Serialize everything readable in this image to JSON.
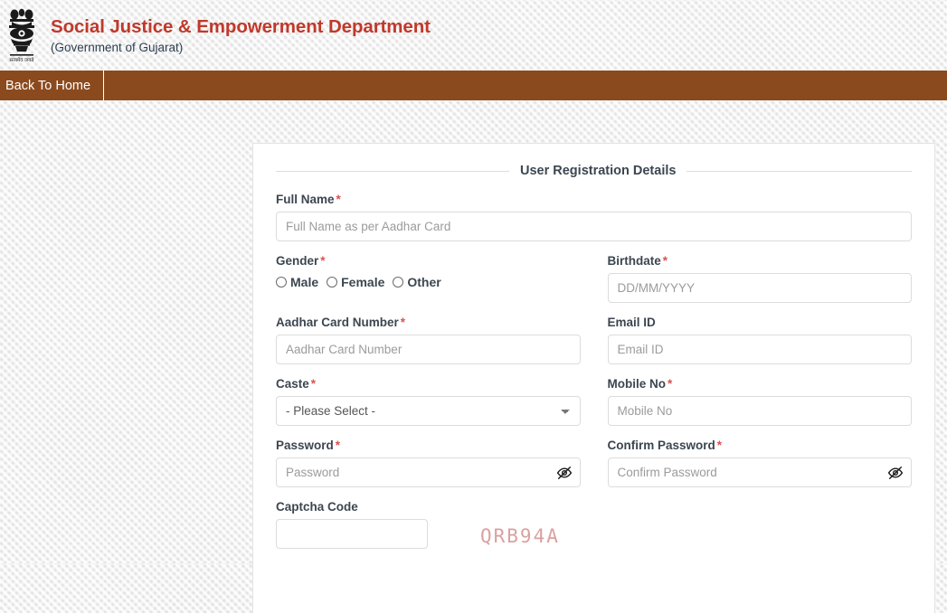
{
  "header": {
    "emblem_icon": "india-national-emblem",
    "title": "Social Justice & Empowerment Department",
    "subtitle": "(Government of Gujarat)",
    "title_color": "#c0392b"
  },
  "navbar": {
    "background_color": "#8b4a1e",
    "items": [
      {
        "label": "Back To Home"
      }
    ]
  },
  "form": {
    "legend": "User Registration Details",
    "required_marker": "*",
    "fields": {
      "full_name": {
        "label": "Full Name",
        "required_marker": "*",
        "placeholder": "Full Name as per Aadhar Card",
        "value": ""
      },
      "gender": {
        "label": "Gender",
        "required_marker": "*",
        "options": [
          "Male",
          "Female",
          "Other"
        ],
        "selected": ""
      },
      "birthdate": {
        "label": "Birthdate",
        "required_marker": "*",
        "placeholder": "DD/MM/YYYY",
        "value": ""
      },
      "aadhar": {
        "label": "Aadhar Card Number",
        "required_marker": "*",
        "placeholder": "Aadhar Card Number",
        "value": ""
      },
      "email": {
        "label": "Email ID",
        "required_marker": "",
        "placeholder": "Email ID",
        "value": ""
      },
      "caste": {
        "label": "Caste",
        "required_marker": "*",
        "selected": "- Please Select -",
        "options": [
          "- Please Select -"
        ]
      },
      "mobile": {
        "label": "Mobile No",
        "required_marker": "*",
        "placeholder": "Mobile No",
        "value": ""
      },
      "password": {
        "label": "Password",
        "required_marker": "*",
        "placeholder": "Password",
        "value": "",
        "toggle_icon": "eye-slash-icon"
      },
      "confirm_password": {
        "label": "Confirm Password",
        "required_marker": "*",
        "placeholder": "Confirm Password",
        "value": "",
        "toggle_icon": "eye-slash-icon"
      },
      "captcha": {
        "label": "Captcha Code",
        "required_marker": "",
        "placeholder": "",
        "value": "",
        "image_text": "QRB94A"
      }
    }
  }
}
